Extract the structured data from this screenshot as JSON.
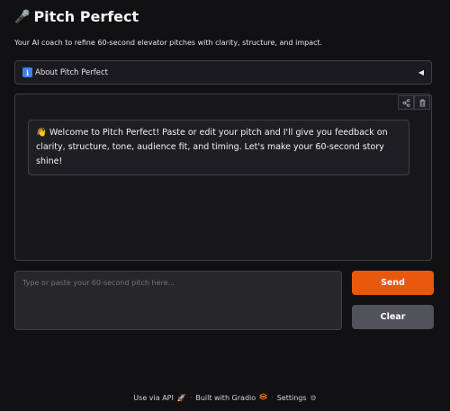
{
  "app": {
    "title": "Pitch Perfect",
    "title_icon": "microphone-icon",
    "subtitle": "Your AI coach to refine 60-second elevator pitches with clarity, structure, and impact."
  },
  "accordion": {
    "icon": "info-icon",
    "icon_glyph": "i",
    "label": "About Pitch Perfect",
    "caret": "◀"
  },
  "chat": {
    "tools": [
      "share-icon",
      "trash-icon"
    ],
    "messages": [
      {
        "role": "assistant",
        "emoji": "👋",
        "text": "Welcome to Pitch Perfect! Paste or edit your pitch and I'll give you feedback on clarity, structure, tone, audience fit, and timing. Let's make your 60-second story shine!"
      }
    ]
  },
  "input": {
    "value": "",
    "placeholder": "Type or paste your 60-second pitch here..."
  },
  "buttons": {
    "send": "Send",
    "clear": "Clear"
  },
  "footer": {
    "api": "Use via API",
    "built": "Built with Gradio",
    "settings": "Settings",
    "separator": "·"
  },
  "colors": {
    "accent": "#ea580c",
    "secondary_button": "#52525b",
    "background": "#111113"
  }
}
